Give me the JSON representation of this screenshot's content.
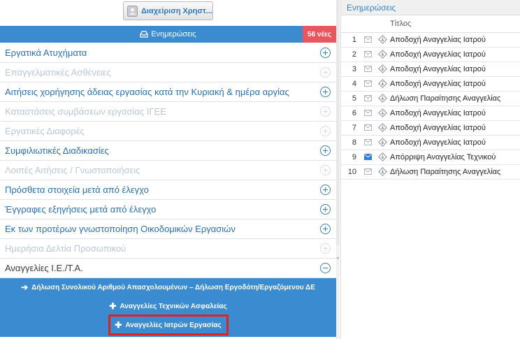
{
  "header": {
    "user_button_label": "Διαχείριση Χρηστ...",
    "updates_label": "Ενημερώσεις",
    "new_badge": "56 νέες"
  },
  "menu": {
    "items": [
      {
        "label": "Εργατικά Ατυχήματα",
        "state": "active"
      },
      {
        "label": "Επαγγελματικές Ασθένειες",
        "state": "disabled"
      },
      {
        "label": "Αιτήσεις χορήγησης άδειας εργασίας κατά την Κυριακή & ημέρα αργίας",
        "state": "active"
      },
      {
        "label": "Καταστάσεις συμβάσεων εργασίας ΙΓΕΕ",
        "state": "disabled"
      },
      {
        "label": "Εργατικές Διαφορές",
        "state": "disabled"
      },
      {
        "label": "Συμφιλιωτικές Διαδικασίες",
        "state": "active"
      },
      {
        "label": "Λοιπές Αιτήσεις / Γνωστοποιήσεις",
        "state": "disabled"
      },
      {
        "label": "Πρόσθετα στοιχεία μετά από έλεγχο",
        "state": "active"
      },
      {
        "label": "Έγγραφες εξηγήσεις μετά από έλεγχο",
        "state": "active"
      },
      {
        "label": "Εκ των προτέρων γνωστοποίηση Οικοδομικών Εργασιών",
        "state": "active"
      },
      {
        "label": "Ημερήσια Δελτία Προσωπικού",
        "state": "disabled"
      },
      {
        "label": "Αναγγελίες Ι.Ε./Τ.Α.",
        "state": "expanded"
      }
    ],
    "submenu": [
      {
        "label": "Δήλωση Συνολικού Αριθμού Απασχολουμένων – Δήλωση Εργοδότη/Εργαζόμενου ΔΕ",
        "icon": "arrow-right-icon"
      },
      {
        "label": "Αναγγελίες Τεχνικών Ασφαλείας",
        "icon": "plus-icon"
      },
      {
        "label": "Αναγγελίες Ιατρών Εργασίας",
        "icon": "plus-icon",
        "selected": true
      }
    ]
  },
  "updates_panel": {
    "title": "Ενημερώσεις",
    "column_title": "Τίτλος",
    "rows": [
      {
        "num": "1",
        "read": true,
        "title": "Αποδοχή Αναγγελίας Ιατρού"
      },
      {
        "num": "2",
        "read": true,
        "title": "Αποδοχή Αναγγελίας Ιατρού"
      },
      {
        "num": "3",
        "read": true,
        "title": "Αποδοχή Αναγγελίας Ιατρού"
      },
      {
        "num": "4",
        "read": true,
        "title": "Αποδοχή Αναγγελίας Ιατρού"
      },
      {
        "num": "5",
        "read": true,
        "title": "Δήλωση Παραίτησης Αναγγελίας"
      },
      {
        "num": "6",
        "read": true,
        "title": "Αποδοχή Αναγγελίας Ιατρού"
      },
      {
        "num": "7",
        "read": true,
        "title": "Αποδοχή Αναγγελίας Ιατρού"
      },
      {
        "num": "8",
        "read": true,
        "title": "Αποδοχή Αναγγελίας Ιατρού"
      },
      {
        "num": "9",
        "read": false,
        "title": "Απόρριψη Αναγγελίας Τεχνικού"
      },
      {
        "num": "10",
        "read": true,
        "title": "Δήλωση Παραίτησης Αναγγελίας"
      }
    ]
  },
  "colors": {
    "primary": "#3a8bd0",
    "badge": "#e8575e",
    "link": "#2a6fae",
    "disabled": "#b9c7d5",
    "highlight": "#e0211f",
    "unread_envelope": "#2f7fd4"
  }
}
